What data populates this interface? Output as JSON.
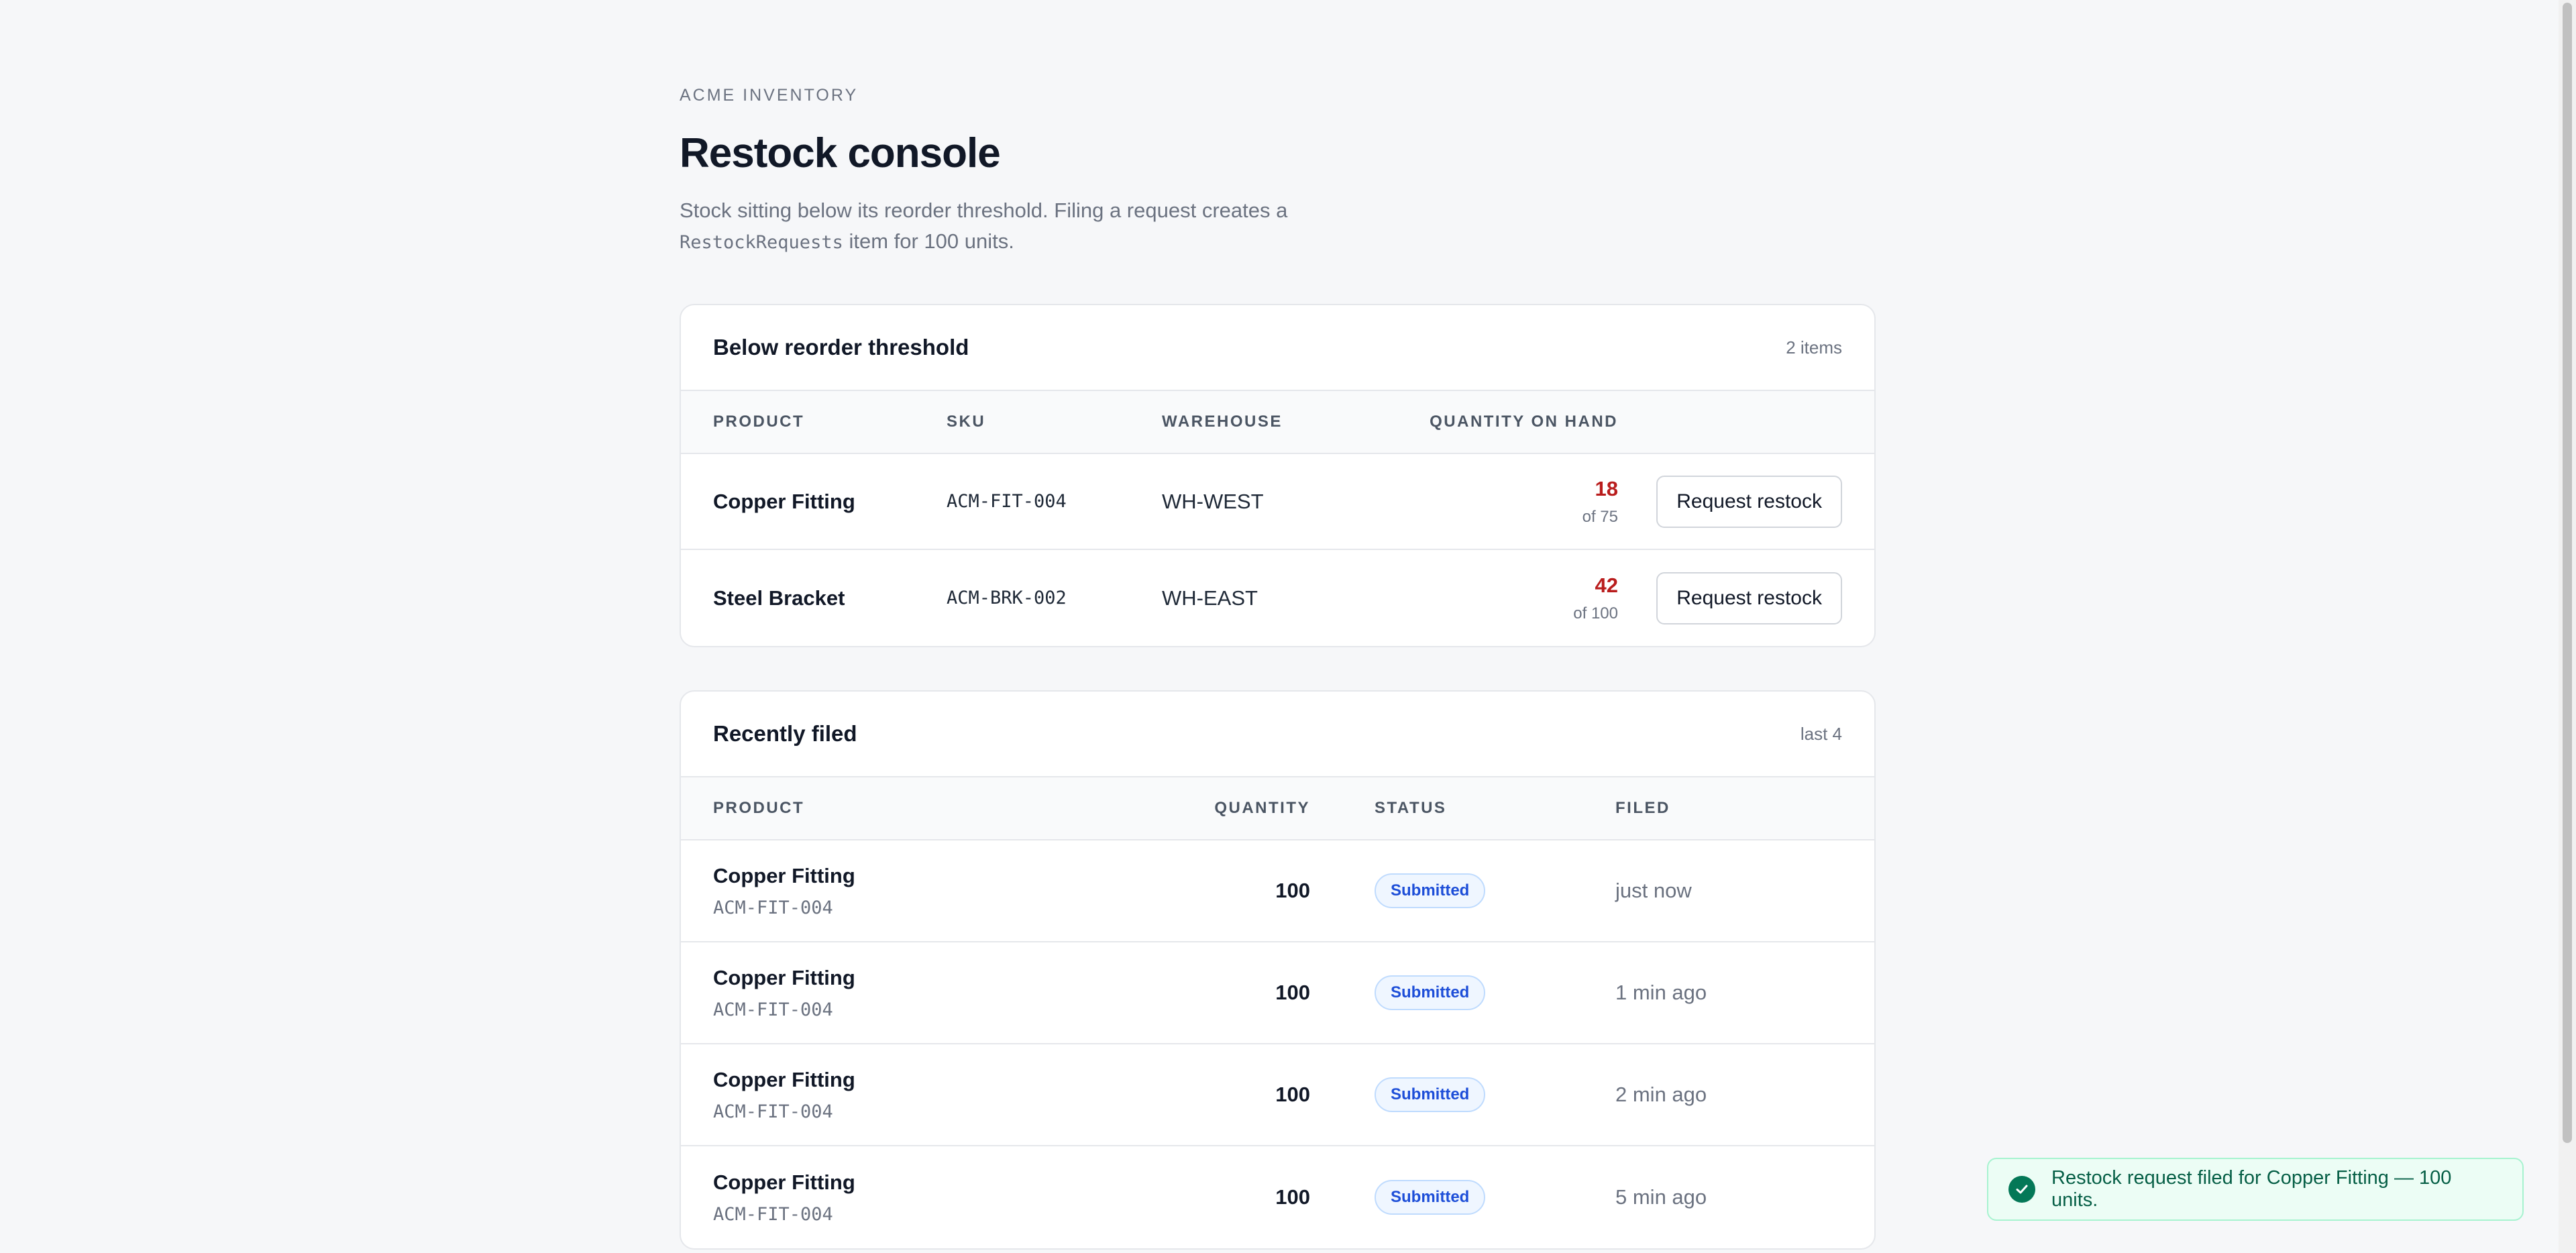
{
  "app": {
    "eyebrow": "ACME INVENTORY",
    "title": "Restock console",
    "description_pre": "Stock sitting below its reorder threshold. Filing a request creates a",
    "description_code": "RestockRequests",
    "description_post": " item for 100 units."
  },
  "threshold": {
    "title": "Below reorder threshold",
    "count": "2 items",
    "columns": [
      "PRODUCT",
      "SKU",
      "WAREHOUSE",
      "QUANTITY ON HAND"
    ],
    "rows": [
      {
        "product": "Copper Fitting",
        "sku": "ACM-FIT-004",
        "warehouse": "WH-WEST",
        "qty": "18",
        "of": "of 75",
        "action": "Request restock"
      },
      {
        "product": "Steel Bracket",
        "sku": "ACM-BRK-002",
        "warehouse": "WH-EAST",
        "qty": "42",
        "of": "of 100",
        "action": "Request restock"
      }
    ]
  },
  "recent": {
    "title": "Recently filed",
    "count": "last 4",
    "columns": [
      "PRODUCT",
      "QUANTITY",
      "STATUS",
      "FILED"
    ],
    "rows": [
      {
        "product": "Copper Fitting",
        "sku": "ACM-FIT-004",
        "qty": "100",
        "status": "Submitted",
        "filed": "just now"
      },
      {
        "product": "Copper Fitting",
        "sku": "ACM-FIT-004",
        "qty": "100",
        "status": "Submitted",
        "filed": "1 min ago"
      },
      {
        "product": "Copper Fitting",
        "sku": "ACM-FIT-004",
        "qty": "100",
        "status": "Submitted",
        "filed": "2 min ago"
      },
      {
        "product": "Copper Fitting",
        "sku": "ACM-FIT-004",
        "qty": "100",
        "status": "Submitted",
        "filed": "5 min ago"
      }
    ]
  },
  "toast": {
    "icon": "check-circle-icon",
    "message": "Restock request filed for Copper Fitting — 100 units."
  },
  "colors": {
    "low_stock": "#b91c1c",
    "status_badge": "#1d4ed8",
    "success": "#047857"
  }
}
